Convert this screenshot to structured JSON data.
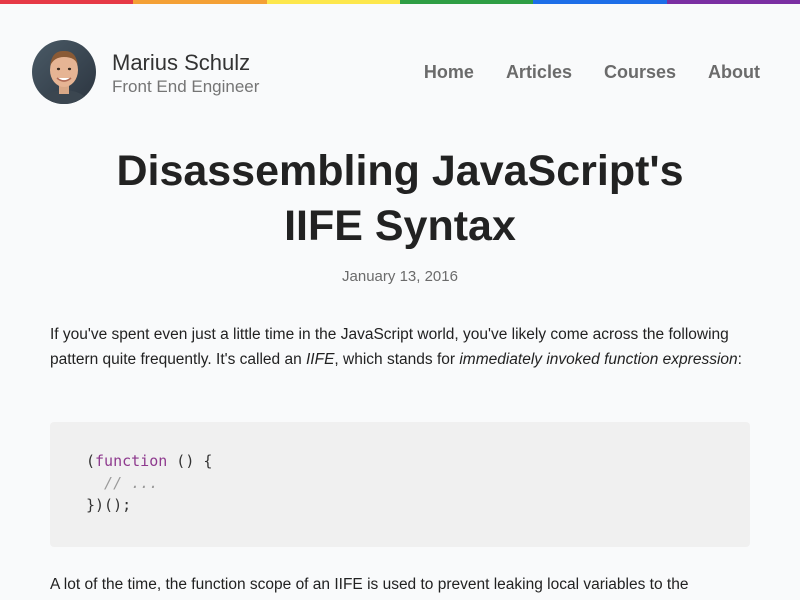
{
  "rainbow_colors": [
    "#e63946",
    "#f4a035",
    "#fde74c",
    "#2f9e44",
    "#1d6ee8",
    "#7b2fa2"
  ],
  "author": {
    "name": "Marius Schulz",
    "role": "Front End Engineer"
  },
  "nav": {
    "items": [
      {
        "label": "Home"
      },
      {
        "label": "Articles"
      },
      {
        "label": "Courses"
      },
      {
        "label": "About"
      }
    ]
  },
  "article": {
    "title_line1": "Disassembling JavaScript's",
    "title_line2": "IIFE Syntax",
    "date": "January 13, 2016",
    "intro_part1": "If you've spent even just a little time in the JavaScript world, you've likely come across the following pattern quite frequently. It's called an ",
    "intro_em1": "IIFE",
    "intro_part2": ", which stands for ",
    "intro_em2": "immediately invoked function expression",
    "intro_part3": ":",
    "code": {
      "line1_open": "(",
      "line1_keyword": "function",
      "line1_rest": " () {",
      "line2_comment": "  // ...",
      "line3": "})();"
    },
    "para2": "A lot of the time, the function scope of an IIFE is used to prevent leaking local variables to the"
  }
}
